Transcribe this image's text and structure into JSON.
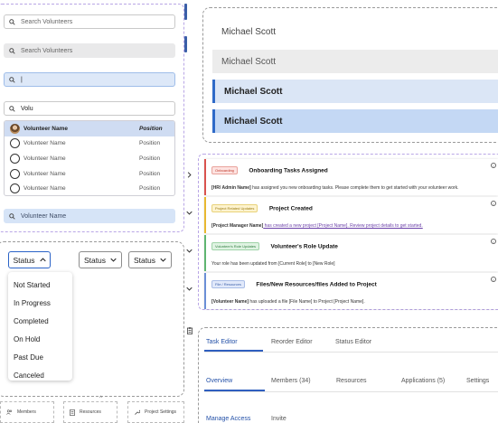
{
  "search": {
    "placeholder_outline": "Search Volunteers",
    "placeholder_gray": "Search Volunteers",
    "typing_value": "|",
    "typed_value": "Volu",
    "selected_value": "Volunteer Name"
  },
  "volunteer_table": {
    "header": {
      "name": "Volunteer Name",
      "position": "Position"
    },
    "rows": [
      {
        "name": "Volunteer Name",
        "position": "Position"
      },
      {
        "name": "Volunteer Name",
        "position": "Position"
      },
      {
        "name": "Volunteer Name",
        "position": "Position"
      },
      {
        "name": "Volunteer Name",
        "position": "Position"
      }
    ]
  },
  "status_dropdowns": {
    "active_label": "Status",
    "default_label": "Status",
    "hover_label": "Status",
    "options": [
      "Not Started",
      "In Progress",
      "Completed",
      "On Hold",
      "Past Due",
      "Canceled"
    ]
  },
  "bottom_nav": [
    {
      "label": "Members",
      "icon": "people-icon"
    },
    {
      "label": "Resources",
      "icon": "document-icon"
    },
    {
      "label": "Project Settings",
      "icon": "wrench-icon"
    }
  ],
  "name_variants": [
    "Michael Scott",
    "Michael Scott",
    "Michael Scott",
    "Michael Scott"
  ],
  "notifications": [
    {
      "tag": "Onboarding",
      "title": "Onboarding Tasks Assigned",
      "body_bold": "[HR/ Admin Name]",
      "body": " has assigned you new onboarding tasks. Please complete them to get started with your volunteer work.",
      "accent": "#d9534f",
      "tag_bg": "#fde3e1",
      "tag_color": "#c0392b"
    },
    {
      "tag": "Project Related Updates",
      "title": "Project Created",
      "body_bold": "[Project Manager Name]",
      "body_link": " has created a new project [Project Name]. Review project details to get started.",
      "accent": "#e8b830",
      "tag_bg": "#fdf3cf",
      "tag_color": "#9a7a10"
    },
    {
      "tag": "Volunteer's Role Updates",
      "title": "Volunteer's Role Update",
      "body": "Your role has been updated from [Current Role] to [New Role]",
      "accent": "#5fb571",
      "tag_bg": "#dff3e2",
      "tag_color": "#2f7d3f"
    },
    {
      "tag": "File / Resources",
      "title": "Files/New Resources/files Added to Project",
      "body_bold": "[Volunteer Name]",
      "body": " has uploaded a file [File Name] to Project [Project Name].",
      "accent": "#6b8fd6",
      "tag_bg": "#e1e9fa",
      "tag_color": "#3a5ea8"
    }
  ],
  "editor_tabs": [
    "Task Editor",
    "Reorder Editor",
    "Status Editor"
  ],
  "project_tabs": [
    "Overview",
    "Members (34)",
    "Resources",
    "Applications (5)",
    "Settings"
  ],
  "access_tabs": [
    "Manage Access",
    "Invite"
  ],
  "colors": {
    "accent_blue": "#2f6ac8",
    "dashed_purple": "#b9a6e6",
    "selected_bg": "#dbe6f6"
  }
}
